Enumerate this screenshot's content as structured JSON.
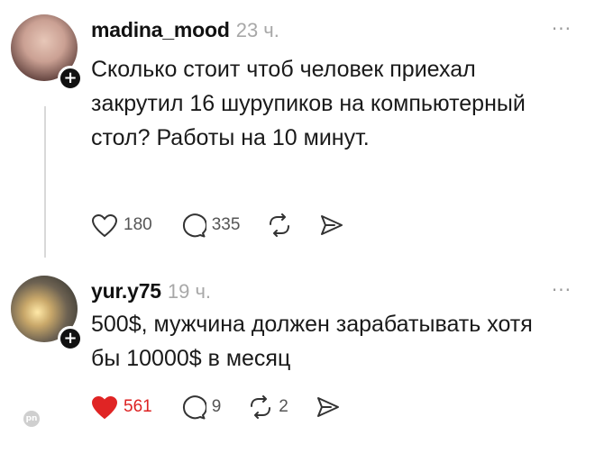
{
  "posts": [
    {
      "username": "madina_mood",
      "time": "23 ч.",
      "more": "···",
      "text": "Сколько стоит чтоб человек приехал закрутил 16 шурупиков на компьютерный стол? Работы на 10 минут.",
      "likes": "180",
      "comments": "335",
      "reposts": "",
      "liked": false
    },
    {
      "username": "yur.y75",
      "time": "19 ч.",
      "more": "···",
      "text": "500$, мужчина должен зарабатывать хотя бы 10000$ в месяц",
      "likes": "561",
      "comments": "9",
      "reposts": "2",
      "liked": true
    }
  ],
  "watermark": "pn",
  "colors": {
    "like_active": "#e02424",
    "icon": "#333333",
    "muted": "#a8a8a8"
  }
}
